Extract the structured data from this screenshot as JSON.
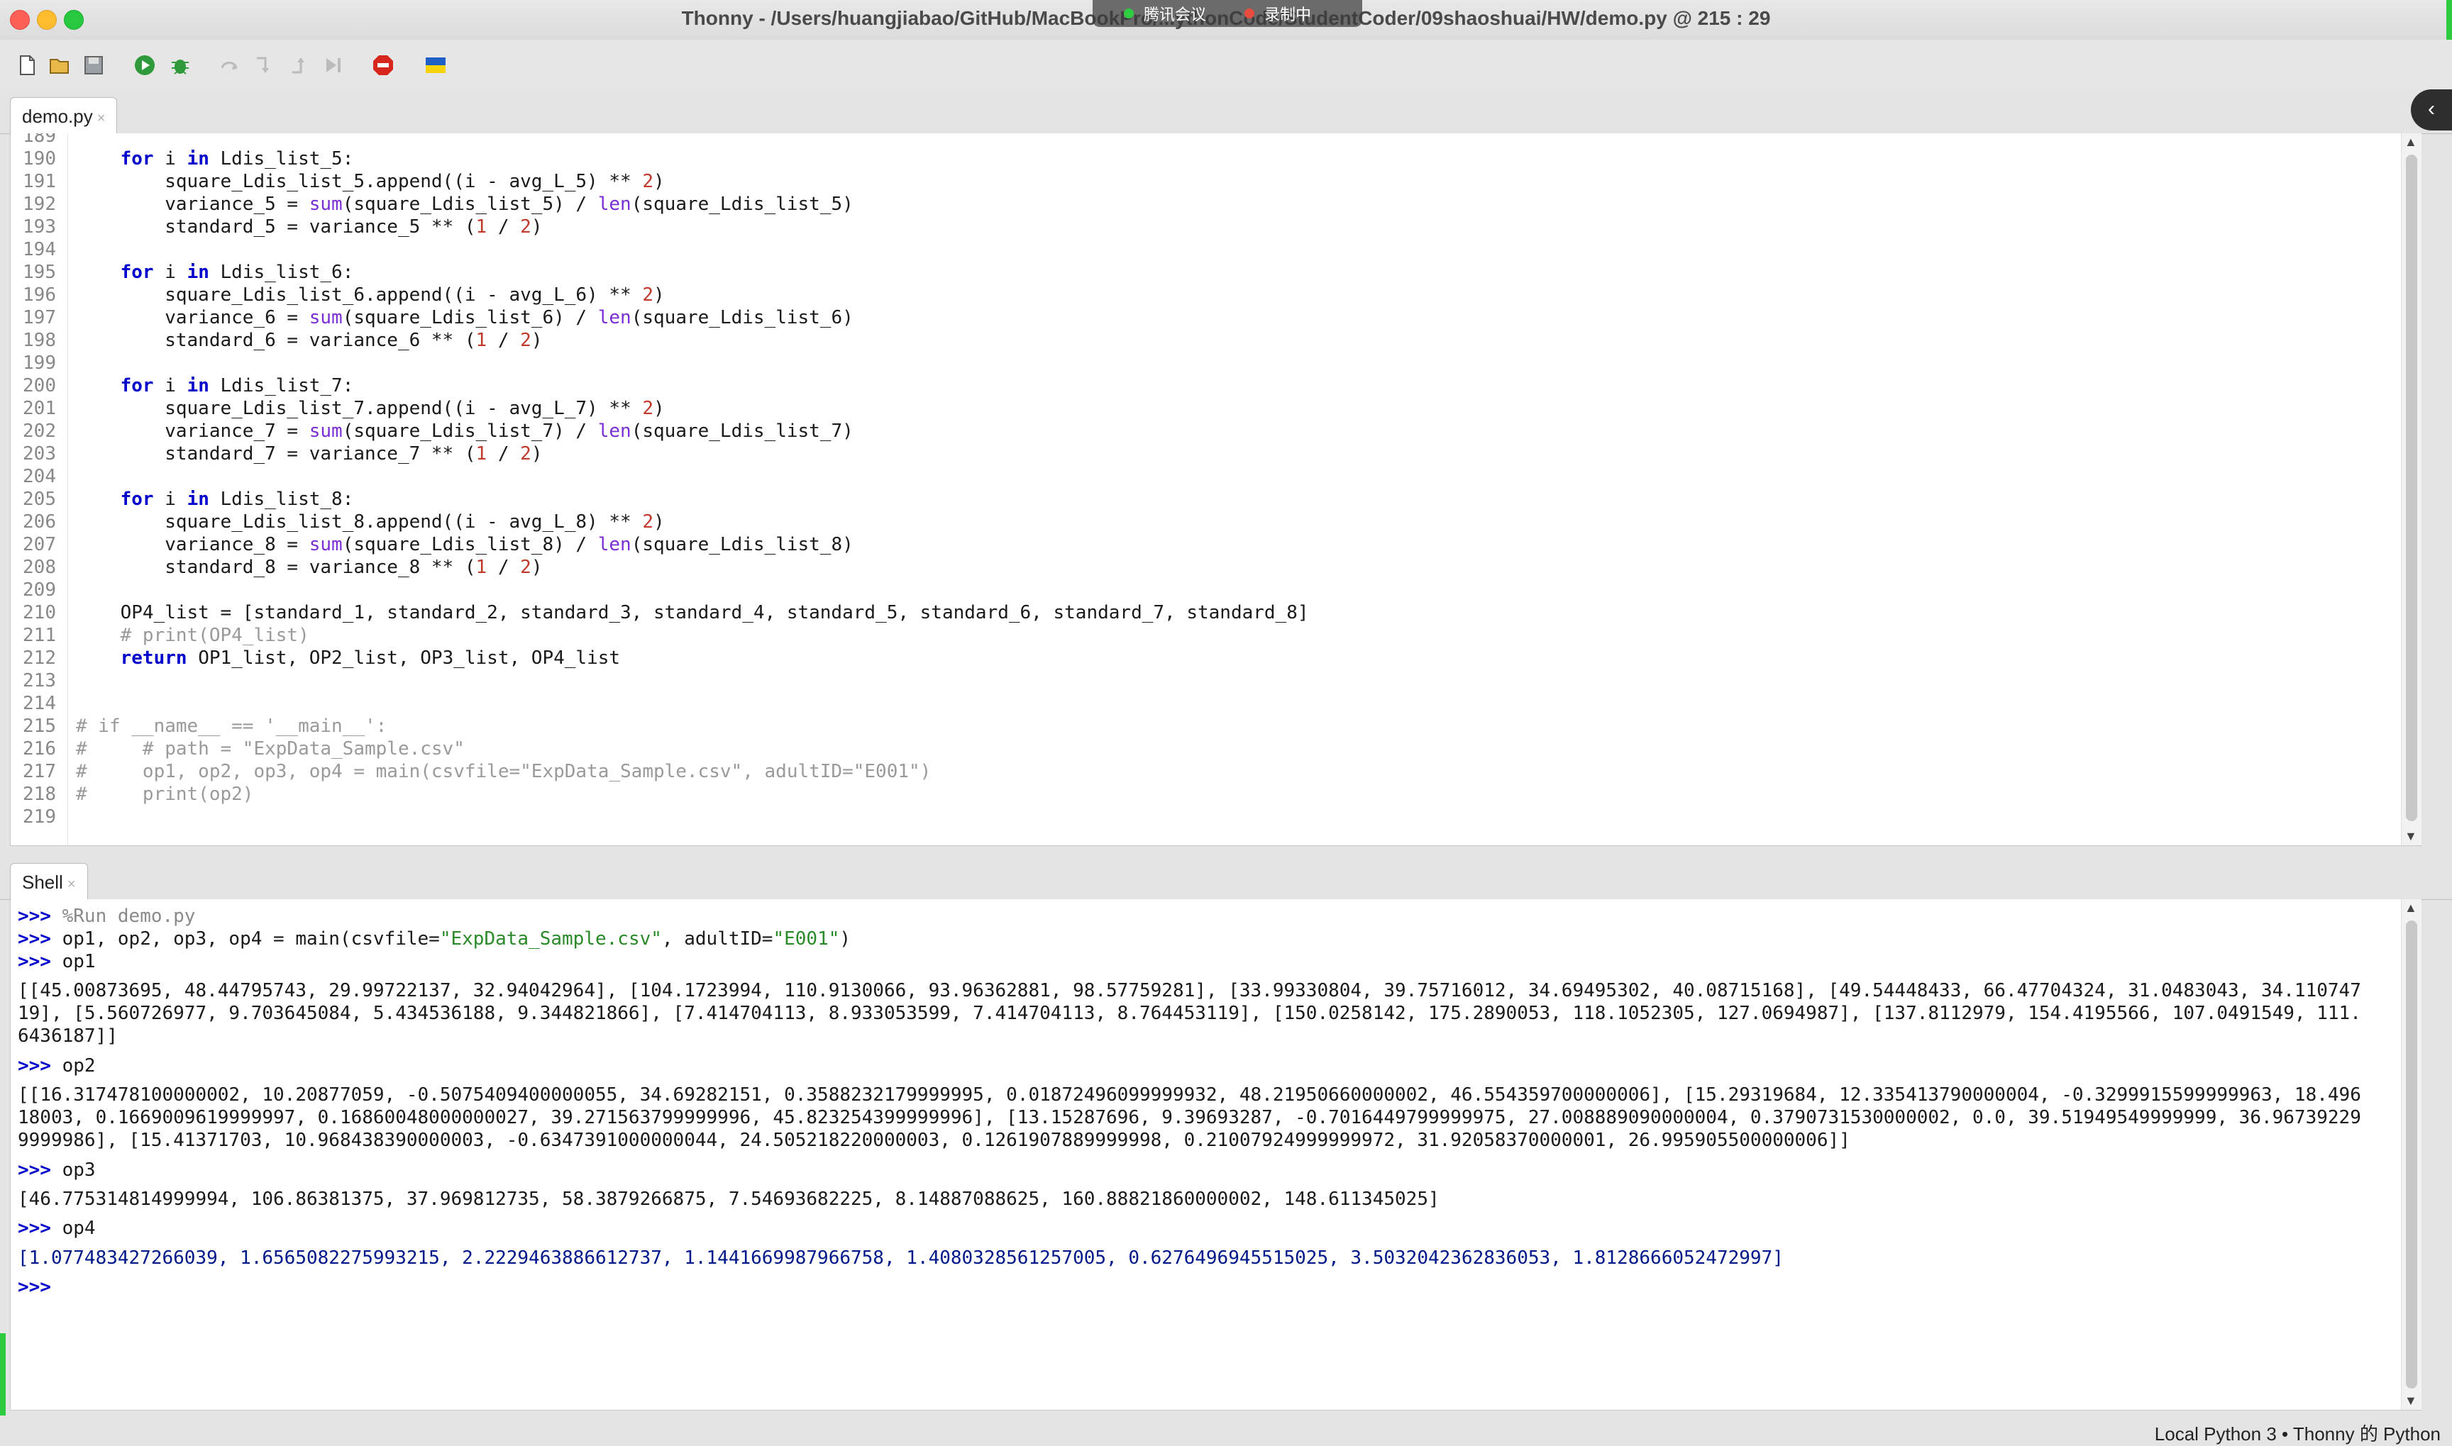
{
  "window": {
    "title": "Thonny  -  /Users/huangjiabao/GitHub/MacBookPro/...ythonCode/StudentCoder/09shaoshuai/HW/demo.py  @  215 : 29",
    "meeting_label": "腾讯会议",
    "recording_label": "录制中"
  },
  "toolbar": {
    "icons": [
      "new-file-icon",
      "open-file-icon",
      "save-icon",
      "run-icon",
      "debug-icon",
      "step-over-icon",
      "step-into-icon",
      "step-out-icon",
      "resume-icon",
      "stop-icon",
      "ukraine-flag-icon"
    ]
  },
  "editor": {
    "tab_label": "demo.py",
    "tab_close": "×",
    "collapse_glyph": "‹",
    "lines": [
      {
        "n": "189",
        "code": ""
      },
      {
        "n": "190",
        "code": "    for i in Ldis_list_5:"
      },
      {
        "n": "191",
        "code": "        square_Ldis_list_5.append((i - avg_L_5) ** 2)"
      },
      {
        "n": "192",
        "code": "        variance_5 = sum(square_Ldis_list_5) / len(square_Ldis_list_5)"
      },
      {
        "n": "193",
        "code": "        standard_5 = variance_5 ** (1 / 2)"
      },
      {
        "n": "194",
        "code": ""
      },
      {
        "n": "195",
        "code": "    for i in Ldis_list_6:"
      },
      {
        "n": "196",
        "code": "        square_Ldis_list_6.append((i - avg_L_6) ** 2)"
      },
      {
        "n": "197",
        "code": "        variance_6 = sum(square_Ldis_list_6) / len(square_Ldis_list_6)"
      },
      {
        "n": "198",
        "code": "        standard_6 = variance_6 ** (1 / 2)"
      },
      {
        "n": "199",
        "code": ""
      },
      {
        "n": "200",
        "code": "    for i in Ldis_list_7:"
      },
      {
        "n": "201",
        "code": "        square_Ldis_list_7.append((i - avg_L_7) ** 2)"
      },
      {
        "n": "202",
        "code": "        variance_7 = sum(square_Ldis_list_7) / len(square_Ldis_list_7)"
      },
      {
        "n": "203",
        "code": "        standard_7 = variance_7 ** (1 / 2)"
      },
      {
        "n": "204",
        "code": ""
      },
      {
        "n": "205",
        "code": "    for i in Ldis_list_8:"
      },
      {
        "n": "206",
        "code": "        square_Ldis_list_8.append((i - avg_L_8) ** 2)"
      },
      {
        "n": "207",
        "code": "        variance_8 = sum(square_Ldis_list_8) / len(square_Ldis_list_8)"
      },
      {
        "n": "208",
        "code": "        standard_8 = variance_8 ** (1 / 2)"
      },
      {
        "n": "209",
        "code": ""
      },
      {
        "n": "210",
        "code": "    OP4_list = [standard_1, standard_2, standard_3, standard_4, standard_5, standard_6, standard_7, standard_8]"
      },
      {
        "n": "211",
        "code": "    # print(OP4_list)"
      },
      {
        "n": "212",
        "code": "    return OP1_list, OP2_list, OP3_list, OP4_list"
      },
      {
        "n": "213",
        "code": ""
      },
      {
        "n": "214",
        "code": ""
      },
      {
        "n": "215",
        "code": "# if __name__ == '__main__':"
      },
      {
        "n": "216",
        "code": "#     # path = \"ExpData_Sample.csv\""
      },
      {
        "n": "217",
        "code": "#     op1, op2, op3, op4 = main(csvfile=\"ExpData_Sample.csv\", adultID=\"E001\")"
      },
      {
        "n": "218",
        "code": "#     print(op2)"
      },
      {
        "n": "219",
        "code": ""
      }
    ]
  },
  "shell": {
    "tab_label": "Shell",
    "tab_close": "×",
    "lines": [
      {
        "prompt": ">>> ",
        "text": "%Run demo.py",
        "style": "runcmd"
      },
      {
        "prompt": ">>> ",
        "text": "op1, op2, op3, op4 = main(csvfile=\"ExpData_Sample.csv\", adultID=\"E001\")",
        "style": "normal"
      },
      {
        "prompt": ">>> ",
        "text": "op1",
        "style": "normal"
      },
      {
        "prompt": "",
        "text": "",
        "style": "normal"
      },
      {
        "prompt": "",
        "text": "[[45.00873695, 48.44795743, 29.99722137, 32.94042964], [104.1723994, 110.9130066, 93.96362881, 98.57759281], [33.99330804, 39.75716012, 34.69495302, 40.08715168], [49.54448433, 66.47704324, 31.0483043, 34.110747",
        "style": "normal"
      },
      {
        "prompt": "",
        "text": "19], [5.560726977, 9.703645084, 5.434536188, 9.344821866], [7.414704113, 8.933053599, 7.414704113, 8.764453119], [150.0258142, 175.2890053, 118.1052305, 127.0694987], [137.8112979, 154.4195566, 107.0491549, 111.",
        "style": "normal"
      },
      {
        "prompt": "",
        "text": "6436187]]",
        "style": "normal"
      },
      {
        "prompt": "",
        "text": "",
        "style": "normal"
      },
      {
        "prompt": ">>> ",
        "text": "op2",
        "style": "normal"
      },
      {
        "prompt": "",
        "text": "",
        "style": "normal"
      },
      {
        "prompt": "",
        "text": "[[16.317478100000002, 10.20877059, -0.5075409400000055, 34.69282151, 0.3588232179999995, 0.01872496099999932, 48.21950660000002, 46.554359700000006], [15.29319684, 12.335413790000004, -0.3299915599999963, 18.496",
        "style": "normal"
      },
      {
        "prompt": "",
        "text": "18003, 0.1669009619999997, 0.16860048000000027, 39.271563799999996, 45.823254399999996], [13.15287696, 9.39693287, -0.7016449799999975, 27.008889090000004, 0.3790731530000002, 0.0, 39.51949549999999, 36.96739229",
        "style": "normal"
      },
      {
        "prompt": "",
        "text": "9999986], [15.41371703, 10.968438390000003, -0.6347391000000044, 24.505218220000003, 0.1261907889999998, 0.21007924999999972, 31.92058370000001, 26.995905500000006]]",
        "style": "normal"
      },
      {
        "prompt": "",
        "text": "",
        "style": "normal"
      },
      {
        "prompt": ">>> ",
        "text": "op3",
        "style": "normal"
      },
      {
        "prompt": "",
        "text": "",
        "style": "normal"
      },
      {
        "prompt": "",
        "text": "[46.775314814999994, 106.86381375, 37.969812735, 58.3879266875, 7.54693682225, 8.14887088625, 160.88821860000002, 148.611345025]",
        "style": "normal"
      },
      {
        "prompt": "",
        "text": "",
        "style": "normal"
      },
      {
        "prompt": ">>> ",
        "text": "op4",
        "style": "normal"
      },
      {
        "prompt": "",
        "text": "",
        "style": "normal"
      },
      {
        "prompt": "",
        "text": "[1.077483427266039, 1.6565082275993215, 2.2229463886612737, 1.1441669987966758, 1.4080328561257005, 0.6276496945515025, 3.5032042362836053, 1.8128666052472997]",
        "style": "blue"
      },
      {
        "prompt": "",
        "text": "",
        "style": "normal"
      },
      {
        "prompt": ">>> ",
        "text": "",
        "style": "normal"
      }
    ]
  },
  "status": {
    "text": "Local Python 3  •  Thonny 的 Python"
  }
}
